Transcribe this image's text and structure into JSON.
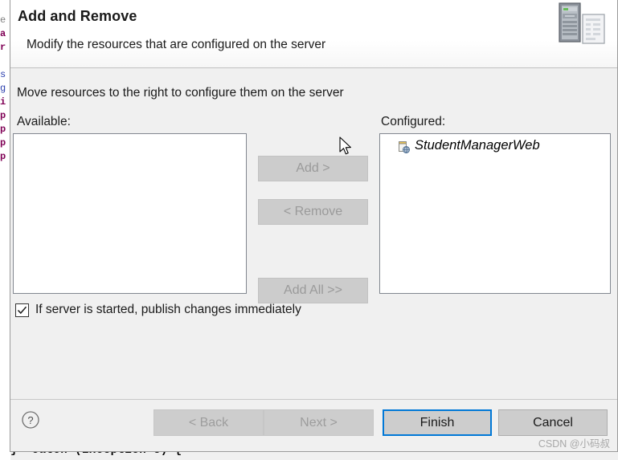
{
  "background": {
    "code_line": "}  catch (Exception e) {",
    "code_keyword": "catch",
    "left_strip_lines": [
      "e",
      "a",
      "r",
      "s",
      "g",
      "i",
      "p",
      "p",
      "p",
      "p"
    ]
  },
  "dialog": {
    "title": "Add and Remove",
    "subtitle": "Modify the resources that are configured on the server",
    "header_icon": "server-and-document-icon",
    "instruction": "Move resources to the right to configure them on the server",
    "available": {
      "label": "Available:",
      "items": []
    },
    "configured": {
      "label": "Configured:",
      "items": [
        {
          "name": "StudentManagerWeb",
          "icon": "web-module-icon"
        }
      ]
    },
    "transfer_buttons": [
      {
        "id": "add",
        "label": "Add >",
        "enabled": false
      },
      {
        "id": "remove",
        "label": "< Remove",
        "enabled": false
      },
      {
        "id": "add-all",
        "label": "Add All >>",
        "enabled": false
      }
    ],
    "publish_option": {
      "label": "If server is started, publish changes immediately",
      "checked": true
    },
    "footer": {
      "help_icon": "help-question-icon",
      "buttons": [
        {
          "id": "back",
          "label": "< Back",
          "state": "disabled"
        },
        {
          "id": "next",
          "label": "Next >",
          "state": "disabled"
        },
        {
          "id": "finish",
          "label": "Finish",
          "state": "default"
        },
        {
          "id": "cancel",
          "label": "Cancel",
          "state": "normal"
        }
      ]
    }
  },
  "watermark": "CSDN @小码叔",
  "colors": {
    "accent_focus": "#0078d7",
    "dialog_bg": "#f0f0f0",
    "button_face": "#cdcdcd",
    "disabled_text": "#9d9d9d",
    "list_bg": "#ffffff",
    "border": "#828790"
  }
}
